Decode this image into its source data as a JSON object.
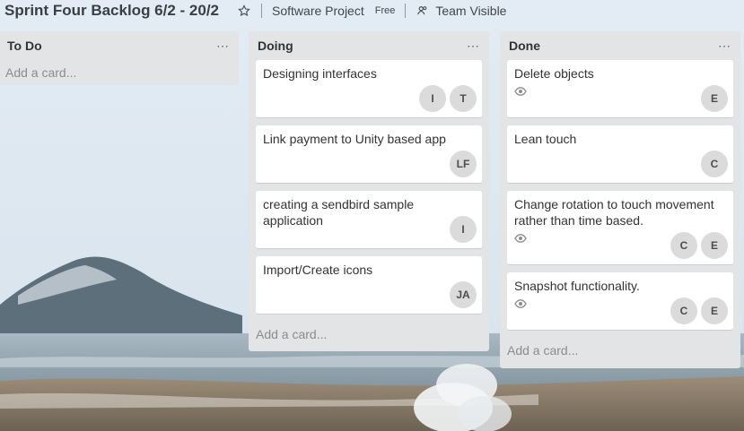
{
  "board": {
    "title": "Sprint Four Backlog 6/2 - 20/2",
    "project": "Software Project",
    "plan": "Free",
    "visibility": "Team Visible"
  },
  "lists": [
    {
      "title": "To Do",
      "menu": "...",
      "add_card": "Add a card..."
    },
    {
      "title": "Doing",
      "menu": "...",
      "add_card": "Add a card...",
      "cards": [
        {
          "title": "Designing interfaces",
          "members": [
            "I",
            "T"
          ]
        },
        {
          "title": "Link payment to Unity based app",
          "members": [
            "LF"
          ]
        },
        {
          "title": "creating a sendbird sample application",
          "members": [
            "I"
          ]
        },
        {
          "title": "Import/Create icons",
          "members": [
            "JA"
          ]
        }
      ]
    },
    {
      "title": "Done",
      "menu": "...",
      "add_card": "Add a card...",
      "cards": [
        {
          "title": "Delete objects",
          "members": [
            "E"
          ],
          "watching": true
        },
        {
          "title": "Lean touch",
          "members": [
            "C"
          ]
        },
        {
          "title": "Change rotation to touch movement rather than time based.",
          "members": [
            "C",
            "E"
          ],
          "watching": true
        },
        {
          "title": "Snapshot functionality.",
          "members": [
            "C",
            "E"
          ],
          "watching": true
        }
      ]
    }
  ],
  "icons": {
    "star": "star-icon",
    "team": "team-icon",
    "watch": "eye-icon"
  },
  "colors": {
    "list_bg": "#e2e4e6",
    "card_bg": "#ffffff",
    "avatar_bg": "#dbdbdb"
  }
}
